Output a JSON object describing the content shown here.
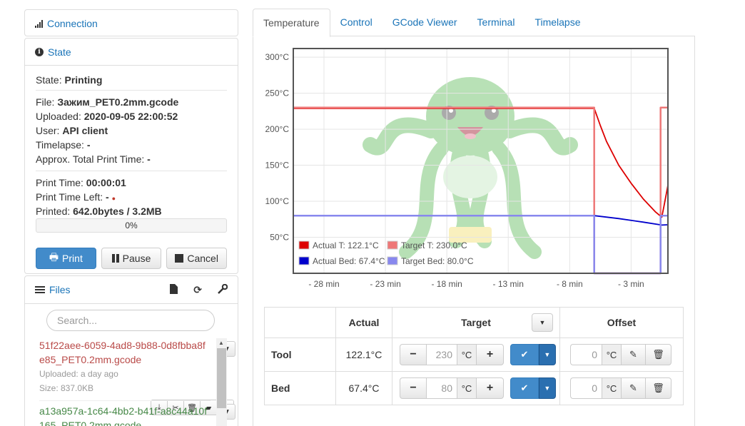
{
  "sidebar": {
    "connection": {
      "label": "Connection"
    },
    "state": {
      "label": "State",
      "state_label": "State:",
      "state_value": "Printing",
      "file_label": "File:",
      "file_value": "Зажим_PET0.2mm.gcode",
      "uploaded_label": "Uploaded:",
      "uploaded_value": "2020-09-05 22:00:52",
      "user_label": "User:",
      "user_value": "API client",
      "timelapse_label": "Timelapse:",
      "timelapse_value": "-",
      "approx_label": "Approx. Total Print Time:",
      "approx_value": "-",
      "print_time_label": "Print Time:",
      "print_time_value": "00:00:01",
      "time_left_label": "Print Time Left:",
      "time_left_value": "-",
      "time_left_dot": "●",
      "printed_label": "Printed:",
      "printed_value": "642.0bytes / 3.2MB",
      "progress_text": "0%",
      "progress_fraction": 0,
      "print_button": "Print",
      "pause_button": "Pause",
      "cancel_button": "Cancel"
    },
    "files": {
      "label": "Files",
      "search_placeholder": "Search...",
      "items": [
        {
          "name": "51f22aee-6059-4ad8-9b88-0d8fbba8fe85_PET0.2mm.gcode",
          "uploaded": "Uploaded: a day ago",
          "size": "Size: 837.0KB",
          "status": "red"
        },
        {
          "name": "a13a957a-1c64-4bb2-b41f-a8c44a10f165_PET0.2mm.gcode",
          "status": "green"
        }
      ]
    }
  },
  "tabs": [
    "Temperature",
    "Control",
    "GCode Viewer",
    "Terminal",
    "Timelapse"
  ],
  "active_tab": "Temperature",
  "colors": {
    "actual_tool": "#dd0000",
    "target_tool": "#ee7777",
    "actual_bed": "#0000cc",
    "target_bed": "#8888ee",
    "link": "#1a74b8",
    "primary": "#428bca",
    "logo": "#7dc87a"
  },
  "chart_data": {
    "type": "line",
    "x_unit": "min",
    "x_ticks": [
      "- 28 min",
      "- 23 min",
      "- 18 min",
      "- 13 min",
      "- 8 min",
      "- 3 min"
    ],
    "x_tick_values": [
      -28,
      -23,
      -18,
      -13,
      -8,
      -3
    ],
    "y_ticks": [
      "300°C",
      "250°C",
      "200°C",
      "150°C",
      "100°C",
      "50°C"
    ],
    "y_tick_values": [
      300,
      250,
      200,
      150,
      100,
      50
    ],
    "xlim": [
      -30.5,
      0
    ],
    "ylim": [
      0,
      312
    ],
    "grid": true,
    "legend_placement": "bottom-left",
    "series": [
      {
        "name": "Actual T: 122.1°C",
        "color_key": "actual_tool",
        "x": [
          -30.5,
          -6.0,
          -5.5,
          -5.0,
          -4.0,
          -3.0,
          -2.0,
          -1.0,
          -0.5,
          -0.3,
          0
        ],
        "y": [
          229,
          229,
          205,
          183,
          150,
          125,
          103,
          85,
          78,
          95,
          122.1
        ]
      },
      {
        "name": "Target T: 230.0°C",
        "color_key": "target_tool",
        "x": [
          -30.5,
          -6.0,
          -6.0,
          -0.6,
          -0.6,
          0
        ],
        "y": [
          230,
          230,
          0,
          0,
          230,
          230
        ]
      },
      {
        "name": "Actual Bed: 67.4°C",
        "color_key": "actual_bed",
        "x": [
          -30.5,
          -6.0,
          -4.0,
          -2.0,
          -0.5,
          0
        ],
        "y": [
          80,
          80,
          76,
          71,
          67,
          67.4
        ]
      },
      {
        "name": "Target Bed: 80.0°C",
        "color_key": "target_bed",
        "x": [
          -30.5,
          -6.0,
          -6.0,
          -0.6,
          -0.6,
          0
        ],
        "y": [
          80,
          80,
          0,
          0,
          80,
          80
        ]
      }
    ]
  },
  "control_table": {
    "headers": {
      "actual": "Actual",
      "target": "Target",
      "offset": "Offset"
    },
    "rows": [
      {
        "label": "Tool",
        "actual": "122.1°C",
        "target_placeholder": "230",
        "offset": "0",
        "unit": "°C"
      },
      {
        "label": "Bed",
        "actual": "67.4°C",
        "target_placeholder": "80",
        "offset": "0",
        "unit": "°C"
      }
    ]
  }
}
